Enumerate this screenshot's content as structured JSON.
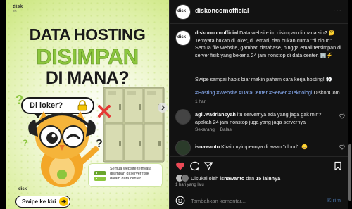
{
  "media": {
    "logo": "disk",
    "logo_sub": "on",
    "headline_1": "DATA HOSTING",
    "headline_2": "DISIMPAN",
    "headline_3": "DI MANA?",
    "bubble": "Di loker?",
    "card_text": "Semua website ternyata disimpan di server fisik dalam data center.",
    "swipe_label": "Swipe ke kiri",
    "brand": "disk"
  },
  "header": {
    "username": "diskoncomofficial",
    "more": "···"
  },
  "caption": {
    "username": "diskoncomofficial",
    "text": "Data website itu disimpan di mana sih? 🤔 Ternyata bukan di loker, di lemari, dan bukan cuma \"di cloud\". Semua file website, gambar, database, hingga email tersimpan di server fisik yang bekerja 24 jam nonstop di data center. 🏢⚡",
    "paragraph_2": "Swipe sampai habis biar makin paham cara kerja hosting! 👀",
    "hashtags": "#Hosting #Website #DataCenter #Server #Teknologi",
    "mention": "DiskonCom",
    "age": "1 hari"
  },
  "comments": [
    {
      "username": "agil.wadriansyah",
      "text": "itu servernya ada yang jaga gak min? apakah 24 jam nonstop juga yang jaga servernya",
      "time": "Sekarang",
      "reply": "Balas"
    },
    {
      "username": "isnawanto",
      "text": "Kirain nyimpennya di awan \"cloud\". 😄"
    }
  ],
  "likes": {
    "prefix": "Disukai oleh",
    "user": "isnawanto",
    "connector": "dan",
    "others": "15 lainnya",
    "time": "1 hari yang lalu"
  },
  "add_comment": {
    "placeholder": "Tambahkan komentar...",
    "post": "Kirim"
  },
  "colors": {
    "accent_green": "#8cc63e",
    "background": "#121212",
    "hashtag": "#8fb5ff",
    "like_red": "#ed4956"
  }
}
